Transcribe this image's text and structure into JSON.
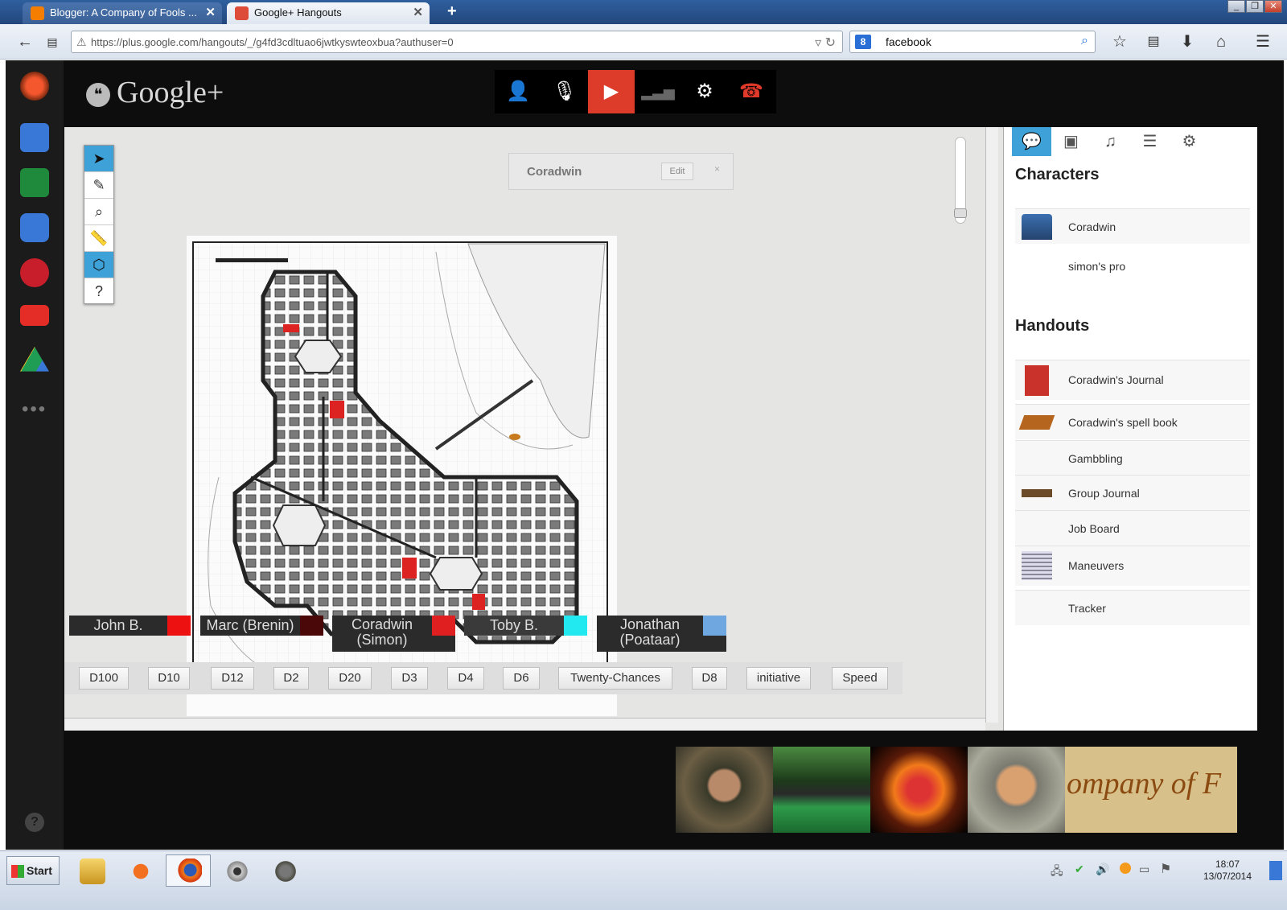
{
  "browser": {
    "tabs": [
      {
        "title": "Blogger: A Company of Fools ...",
        "active": false,
        "icon": "blogger-icon"
      },
      {
        "title": "Google+ Hangouts",
        "active": true,
        "icon": "gplus-icon"
      }
    ],
    "new_tab": "+",
    "url": "https://plus.google.com/hangouts/_/g4fd3cdltuao6jwtkyswteoxbua?authuser=0",
    "search_value": "facebook",
    "search_engine": "8"
  },
  "hangout": {
    "logo": "Google+",
    "toolbar_icons": [
      "invite-person-icon",
      "mute-mic-icon",
      "camera-off-icon",
      "bandwidth-icon",
      "settings-icon",
      "hang-up-icon"
    ],
    "left_rail_icons": [
      "hangout-app-icon",
      "chat-icon",
      "screenshare-icon",
      "capture-icon",
      "roll20-icon",
      "youtube-icon",
      "drive-icon",
      "more-icon"
    ],
    "help": "?"
  },
  "roll20": {
    "tools": [
      "select-tool-icon",
      "draw-tool-icon",
      "zoom-tool-icon",
      "measure-tool-icon",
      "dice-tool-icon",
      "help-tool-icon"
    ],
    "turn_order": {
      "name": "Coradwin",
      "edit": "Edit",
      "close": "×"
    },
    "players": [
      {
        "name": "John B.",
        "color": "#ee1111"
      },
      {
        "name": "Marc (Brenin)",
        "color": "#4a0808"
      },
      {
        "name": "Coradwin (Simon)",
        "color": "#e02020"
      },
      {
        "name": "Toby B.",
        "color": "#22e8f0"
      },
      {
        "name": "Jonathan (Poataar)",
        "color": "#6fa8e0"
      }
    ],
    "macros": [
      "D100",
      "D10",
      "D12",
      "D2",
      "D20",
      "D3",
      "D4",
      "D6",
      "Twenty-Chances",
      "D8",
      "initiative",
      "Speed"
    ]
  },
  "journal": {
    "tabs": [
      "chat-tab-icon",
      "art-tab-icon",
      "jukebox-tab-icon",
      "journal-tab-icon",
      "settings-tab-icon"
    ],
    "characters_heading": "Characters",
    "characters": [
      {
        "name": "Coradwin",
        "thumb": true
      },
      {
        "name": "simon's pro",
        "thumb": false
      }
    ],
    "handouts_heading": "Handouts",
    "handouts": [
      {
        "name": "Coradwin's Journal",
        "thumb": "book-red"
      },
      {
        "name": "Coradwin's spell book",
        "thumb": "book-brown"
      },
      {
        "name": "Gambbling",
        "thumb": ""
      },
      {
        "name": "Group Journal",
        "thumb": "book-open"
      },
      {
        "name": "Job Board",
        "thumb": ""
      },
      {
        "name": "Maneuvers",
        "thumb": "sheet"
      },
      {
        "name": "Tracker",
        "thumb": ""
      }
    ]
  },
  "video_strip": {
    "banner_text": "ompany of F"
  },
  "taskbar": {
    "start": "Start",
    "apps": [
      "explorer-icon",
      "avast-icon",
      "firefox-icon",
      "webcam-icon",
      "gimp-icon"
    ],
    "time": "18:07",
    "date": "13/07/2014"
  }
}
